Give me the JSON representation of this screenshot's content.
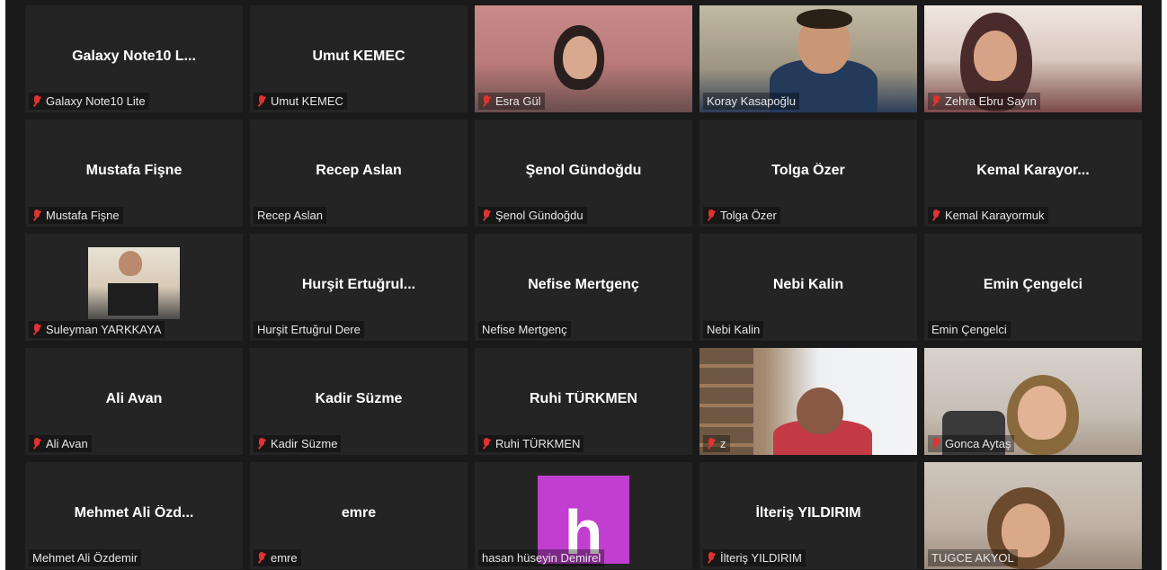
{
  "participants": [
    {
      "display": "Galaxy Note10 L...",
      "label": "Galaxy Note10 Lite",
      "muted": true
    },
    {
      "display": "Umut KEMEC",
      "label": "Umut KEMEC",
      "muted": true
    },
    {
      "display": "",
      "label": "Esra Gül",
      "muted": true,
      "video": "esra"
    },
    {
      "display": "",
      "label": "Koray Kasapoğlu",
      "muted": false,
      "video": "koray",
      "active": true
    },
    {
      "display": "",
      "label": "Zehra Ebru Sayın",
      "muted": true,
      "video": "zehra"
    },
    {
      "display": "Mustafa Fişne",
      "label": "Mustafa Fişne",
      "muted": true
    },
    {
      "display": "Recep Aslan",
      "label": "Recep Aslan",
      "muted": false
    },
    {
      "display": "Şenol Gündoğdu",
      "label": "Şenol Gündoğdu",
      "muted": true
    },
    {
      "display": "Tolga Özer",
      "label": "Tolga Özer",
      "muted": true
    },
    {
      "display": "Kemal  Karayor...",
      "label": "Kemal Karayormuk",
      "muted": true
    },
    {
      "display": "",
      "label": "Suleyman YARKKAYA",
      "muted": true,
      "video": "suleyman"
    },
    {
      "display": "Hurşit  Ertuğrul...",
      "label": "Hurşit Ertuğrul Dere",
      "muted": false
    },
    {
      "display": "Nefise Mertgenç",
      "label": "Nefise Mertgenç",
      "muted": false
    },
    {
      "display": "Nebi Kalin",
      "label": "Nebi Kalin",
      "muted": false
    },
    {
      "display": "Emin Çengelci",
      "label": "Emin Çengelci",
      "muted": false
    },
    {
      "display": "Ali Avan",
      "label": "Ali Avan",
      "muted": true
    },
    {
      "display": "Kadir Süzme",
      "label": "Kadir Süzme",
      "muted": true
    },
    {
      "display": "Ruhi TÜRKMEN",
      "label": "Ruhi TÜRKMEN",
      "muted": true
    },
    {
      "display": "",
      "label": "z",
      "muted": true,
      "video": "z"
    },
    {
      "display": "",
      "label": "Gonca Aytaş",
      "muted": true,
      "video": "gonca"
    },
    {
      "display": "Mehmet  Ali  Özd...",
      "label": "Mehmet Ali Özdemir",
      "muted": false
    },
    {
      "display": "emre",
      "label": "emre",
      "muted": true
    },
    {
      "display": "",
      "label": "hasan hüseyin Demirel",
      "muted": false,
      "video": "hasan"
    },
    {
      "display": "İlteriş YILDIRIM",
      "label": "İlteriş YILDIRIM",
      "muted": true
    },
    {
      "display": "",
      "label": "TUGCE AKYOL",
      "muted": false,
      "video": "tugce"
    }
  ],
  "colors": {
    "active_speaker_border": "#e3ea3a",
    "muted_icon": "#e0332f",
    "tile_background": "#242424"
  }
}
